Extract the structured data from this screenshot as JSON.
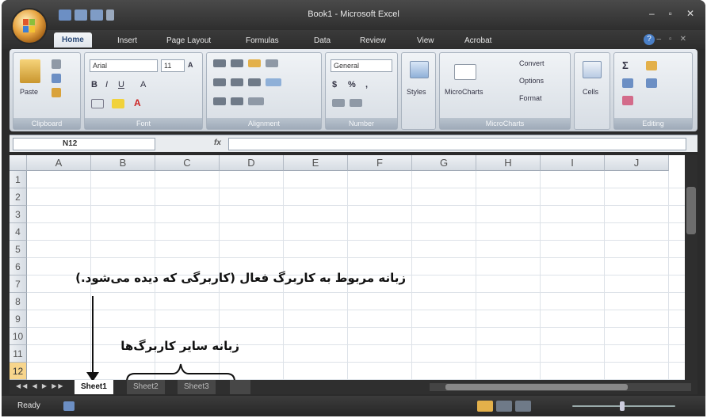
{
  "title": "Book1 - Microsoft Excel",
  "tabs": [
    "Home",
    "Insert",
    "Page Layout",
    "Formulas",
    "Data",
    "Review",
    "View",
    "Acrobat"
  ],
  "ribbon": {
    "clipboard": {
      "label": "Clipboard",
      "paste": "Paste"
    },
    "font": {
      "label": "Font",
      "name": "Arial",
      "size": "11"
    },
    "alignment": {
      "label": "Alignment"
    },
    "number": {
      "label": "Number",
      "format": "General"
    },
    "styles": {
      "label": "Styles"
    },
    "microcharts": {
      "label": "MicroCharts",
      "button": "MicroCharts",
      "convert": "Convert",
      "options": "Options",
      "format": "Format"
    },
    "cells": {
      "label": "Cells"
    },
    "editing": {
      "label": "Editing"
    }
  },
  "formula_bar": {
    "name_box": "N12",
    "fx": "fx",
    "value": ""
  },
  "columns": [
    "A",
    "B",
    "C",
    "D",
    "E",
    "F",
    "G",
    "H",
    "I",
    "J"
  ],
  "rows": [
    "1",
    "2",
    "3",
    "4",
    "5",
    "6",
    "7",
    "8",
    "9",
    "10",
    "11",
    "12"
  ],
  "annotations": {
    "active_tab_note": "زبانه مربوط به کاربرگ فعال (کاربرگی که دیده می‌شود.)",
    "other_tabs_note": "زبانه سایر کاربرگ‌ها"
  },
  "sheets": [
    {
      "name": "Sheet1",
      "active": true
    },
    {
      "name": "Sheet2",
      "active": false
    },
    {
      "name": "Sheet3",
      "active": false
    }
  ],
  "status": {
    "text": "Ready"
  },
  "colors": {
    "chrome": "#2b2b2b",
    "ribbon": "#dfe4ea",
    "active_row": "#f7d58c"
  }
}
